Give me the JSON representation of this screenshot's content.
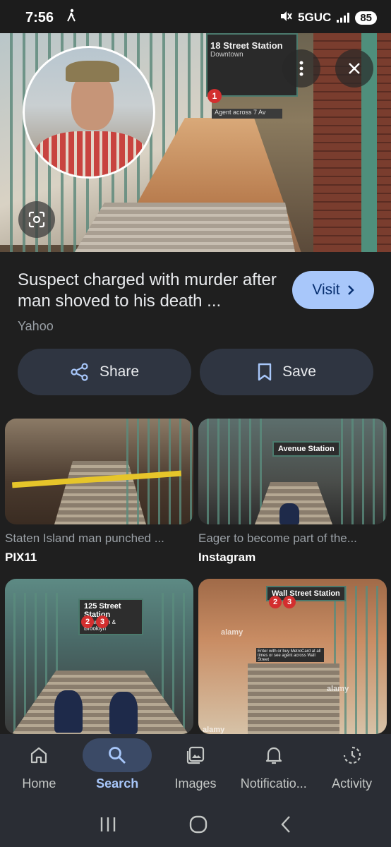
{
  "status_bar": {
    "time": "7:56",
    "network": "5GUC",
    "battery": "85"
  },
  "hero": {
    "sign_title": "18 Street Station",
    "sign_sub": "Downtown",
    "sign_line": "1",
    "agent_sign": "Agent across 7 Av"
  },
  "result": {
    "title": "Suspect charged with murder after man shoved to his death ...",
    "source": "Yahoo",
    "visit_label": "Visit"
  },
  "actions": {
    "share_label": "Share",
    "save_label": "Save"
  },
  "related": [
    {
      "caption": "Staten Island man punched ...",
      "source": "PIX11"
    },
    {
      "caption": "Eager to become part of the...",
      "source": "Instagram",
      "sign": "Avenue Station"
    },
    {
      "sign": "125 Street Station",
      "sign_sub": "Downtown & Brooklyn",
      "lines": [
        "2",
        "3"
      ]
    },
    {
      "sign": "Wall Street Station",
      "lines": [
        "2",
        "3"
      ],
      "watermark": "alamy",
      "metrocard_text": "Enter with or buy MetroCard at all times or see agent across Wall Street"
    }
  ],
  "bottom_nav": [
    {
      "label": "Home",
      "icon": "home-icon",
      "active": false
    },
    {
      "label": "Search",
      "icon": "search-icon",
      "active": true
    },
    {
      "label": "Images",
      "icon": "images-icon",
      "active": false
    },
    {
      "label": "Notificatio...",
      "icon": "bell-icon",
      "active": false
    },
    {
      "label": "Activity",
      "icon": "activity-icon",
      "active": false
    }
  ],
  "colors": {
    "background": "#1f1f1f",
    "accent": "#a8c7fa",
    "button_bg": "#2f3541",
    "nav_bg": "#2a2d34"
  }
}
